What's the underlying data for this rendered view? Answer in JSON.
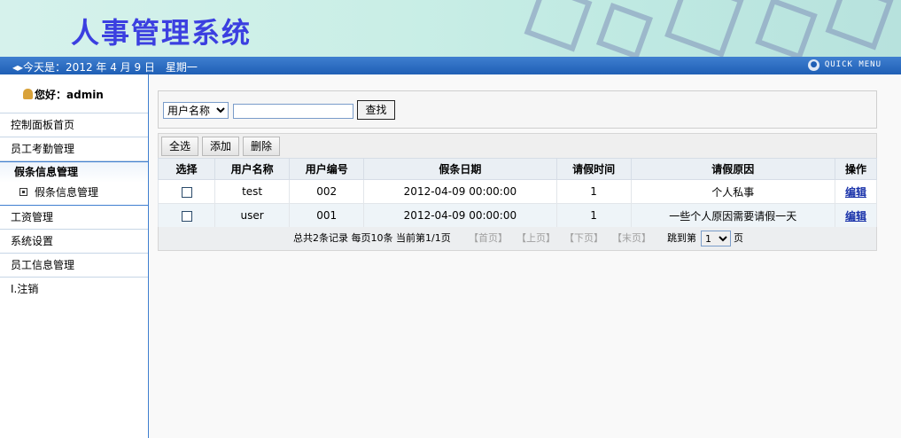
{
  "banner": {
    "title": "人事管理系统"
  },
  "datebar": {
    "date_text": "今天是：2012 年 4 月 9 日　星期一",
    "quick_menu": "QUICK MENU"
  },
  "sidebar": {
    "greeting": "您好：admin",
    "items": [
      {
        "label": "控制面板首页"
      },
      {
        "label": "员工考勤管理"
      },
      {
        "label": "假条信息管理"
      },
      {
        "label": "假条信息管理"
      },
      {
        "label": "工资管理"
      },
      {
        "label": "系统设置"
      },
      {
        "label": "员工信息管理"
      },
      {
        "label": "I.注销"
      }
    ]
  },
  "search": {
    "field_selected": "用户名称",
    "input_value": "",
    "button_label": "查找"
  },
  "toolbar": {
    "select_all": "全选",
    "add": "添加",
    "delete": "删除"
  },
  "table": {
    "headers": [
      "选择",
      "用户名称",
      "用户编号",
      "假条日期",
      "请假时间",
      "请假原因",
      "操作"
    ],
    "rows": [
      {
        "user": "test",
        "id": "002",
        "date": "2012-04-09 00:00:00",
        "days": "1",
        "reason": "个人私事",
        "action": "编辑"
      },
      {
        "user": "user",
        "id": "001",
        "date": "2012-04-09 00:00:00",
        "days": "1",
        "reason": "一些个人原因需要请假一天",
        "action": "编辑"
      }
    ]
  },
  "pager": {
    "summary": "总共2条记录  每页10条  当前第1/1页",
    "first": "【首页】",
    "prev": "【上页】",
    "next": "【下页】",
    "last": "【末页】",
    "jump_prefix": "跳到第",
    "jump_value": "1",
    "jump_suffix": "页"
  }
}
